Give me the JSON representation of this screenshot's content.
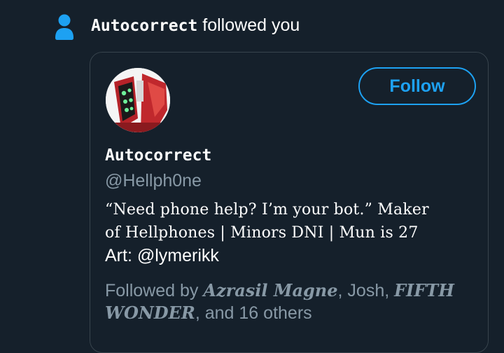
{
  "notification": {
    "user_name": "Autocorrect",
    "action": " followed you",
    "icon": "person-icon",
    "icon_color": "#1da1f2"
  },
  "card": {
    "avatar_icon": "avatar",
    "follow_label": "Follow",
    "display_name": "Autocorrect",
    "handle": "@Hellph0ne",
    "bio": {
      "line1": "“Need phone help? I’m your bot.” Maker",
      "line2": "of Hellphones | Minors DNI | Mun is 27",
      "line3": "Art: @lymerikk"
    },
    "followed_by": {
      "prefix": "Followed by ",
      "name1": "Azrasil Magne",
      "sep1": ", Josh, ",
      "name2_part1": "FIFTH",
      "name2_part2": "WONDER",
      "suffix": ", and 16 others"
    }
  },
  "colors": {
    "background": "#15202b",
    "accent": "#1da1f2",
    "secondary_text": "#8899a6",
    "border": "#38444d"
  }
}
